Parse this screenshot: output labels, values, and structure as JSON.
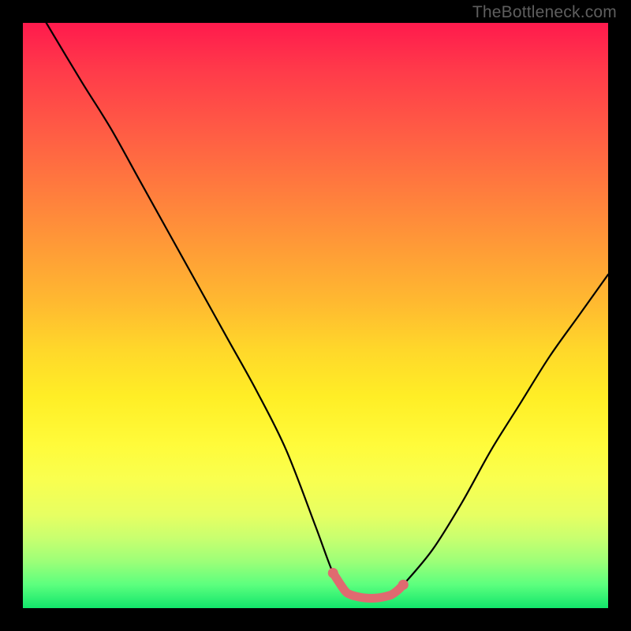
{
  "watermark": "TheBottleneck.com",
  "chart_data": {
    "type": "line",
    "title": "",
    "xlabel": "",
    "ylabel": "",
    "xlim": [
      0,
      100
    ],
    "ylim": [
      0,
      100
    ],
    "series": [
      {
        "name": "black-curve",
        "color": "#000000",
        "x": [
          4,
          10,
          15,
          20,
          25,
          30,
          35,
          40,
          45,
          50,
          53,
          55,
          57,
          60,
          63,
          65,
          70,
          75,
          80,
          85,
          90,
          95,
          100
        ],
        "y": [
          100,
          90,
          82,
          73,
          64,
          55,
          46,
          37,
          27,
          14,
          6,
          3,
          2,
          2,
          2,
          4,
          10,
          18,
          27,
          35,
          43,
          50,
          57
        ]
      },
      {
        "name": "pink-marker-band",
        "color": "#e06a70",
        "x": [
          53,
          55,
          56,
          57,
          58,
          59,
          60,
          61,
          62,
          63,
          64,
          65
        ],
        "y": [
          6,
          3,
          2.3,
          2,
          1.8,
          1.7,
          1.7,
          1.8,
          2,
          2.3,
          3,
          4
        ]
      }
    ]
  }
}
